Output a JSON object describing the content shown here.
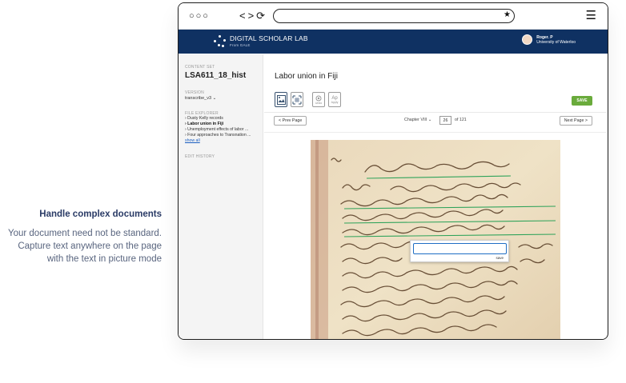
{
  "caption": {
    "heading": "Handle complex documents",
    "body": "Your document need not be standard. Capture text anywhere on the page with the text in picture mode"
  },
  "browser": {
    "dots": "○○○",
    "nav_glyphs": "<>⟳"
  },
  "app": {
    "brand": "DIGITAL SCHOLAR LAB",
    "brand_sub": "From GALE",
    "user_name": "Roger. P",
    "user_org": "University of Waterloo",
    "header_bg": "#0f3162"
  },
  "sidebar": {
    "content_set_label": "CONTENT SET",
    "content_set_name": "LSA611_18_hist",
    "version_label": "VERSION",
    "version_value": "transcribe_v3",
    "file_explorer_label": "FILE EXPLORER",
    "files": [
      {
        "label": "Dusty Kelly records",
        "active": false
      },
      {
        "label": "Labor union in Fiji",
        "active": true
      },
      {
        "label": "Unemployment effects of labor ...",
        "active": false
      },
      {
        "label": "Four approaches to Transnation ...",
        "active": false
      }
    ],
    "files_link": "show all",
    "edit_history_label": "EDIT HISTORY"
  },
  "main": {
    "title": "Labor union in Fiji",
    "tools": [
      {
        "icon": "image-mode-icon",
        "selected": true
      },
      {
        "icon": "text-in-picture-icon",
        "selected": false
      },
      {
        "icon": "undo-icon",
        "label": "Undo"
      },
      {
        "icon": "apply-icon",
        "label": "Apply",
        "glyph": "Ap"
      }
    ],
    "save_label": "SAVE",
    "save_color": "#6aab3c",
    "prev_label": "< Prev Page",
    "chapter": "Chapter VIII",
    "page_number": "26",
    "page_total": "of 121",
    "next_label": "Next Page >"
  },
  "document": {
    "popup_save_label": "save"
  }
}
